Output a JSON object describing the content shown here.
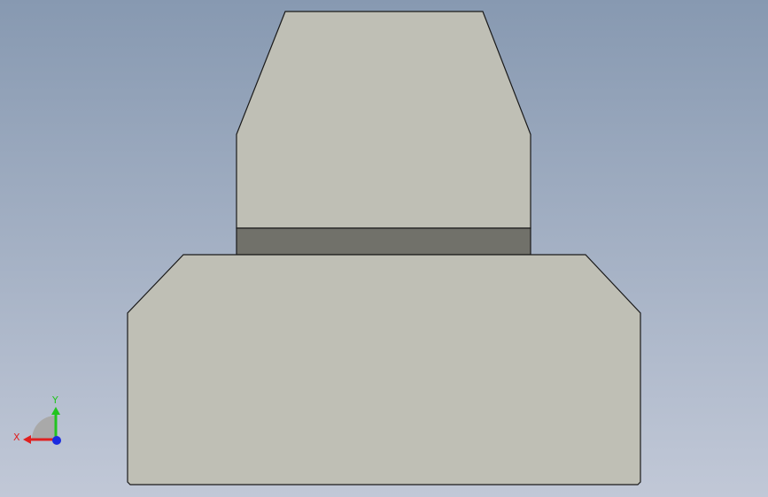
{
  "viewport": {
    "background_top": "#8799b1",
    "background_bottom": "#c1c8d7"
  },
  "model": {
    "face_color": "#bfbfb5",
    "band_color": "#71716a",
    "edge_color": "#1a1a1a"
  },
  "triad": {
    "x_label": "X",
    "y_label": "Y",
    "x_color": "#e02020",
    "y_color": "#22c41f",
    "z_color": "#1a2be0",
    "plane_color": "#a9a9a9"
  }
}
